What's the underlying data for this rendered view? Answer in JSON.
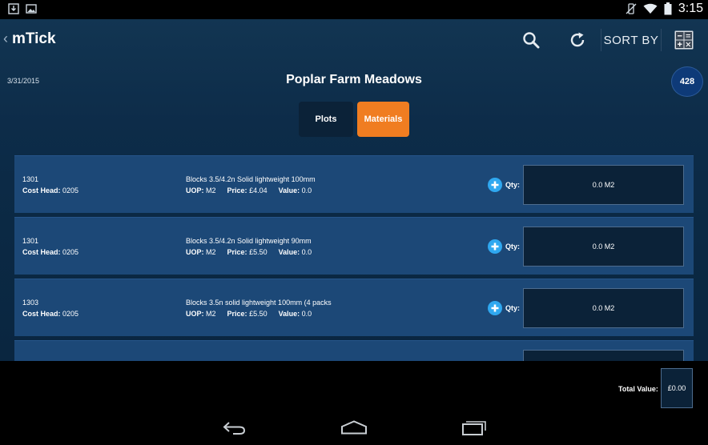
{
  "status": {
    "time": "3:15",
    "icons": [
      "download-icon",
      "image-icon",
      "vibrate-off-icon",
      "wifi-icon",
      "battery-icon"
    ]
  },
  "app": {
    "title": "mTick",
    "sort_label": "SORT BY",
    "date": "3/31/2015",
    "site_name": "Poplar Farm Meadows",
    "badge_count": "428"
  },
  "tabs": {
    "plots": "Plots",
    "materials": "Materials",
    "active": "materials",
    "active_color": "#f07d21"
  },
  "materials": [
    {
      "code": "1301",
      "cost_head_label": "Cost Head:",
      "cost_head": "0205",
      "description": "Blocks 3.5/4.2n Solid lightweight 100mm",
      "uop_label": "UOP:",
      "uop": "M2",
      "price_label": "Price:",
      "price": "£4.04",
      "value_label": "Value:",
      "value": "0.0",
      "qty_label": "Qty:",
      "qty": "0.0 M2"
    },
    {
      "code": "1301",
      "cost_head_label": "Cost Head:",
      "cost_head": "0205",
      "description": "Blocks 3.5/4.2n Solid lightweight 90mm",
      "uop_label": "UOP:",
      "uop": "M2",
      "price_label": "Price:",
      "price": "£5.50",
      "value_label": "Value:",
      "value": "0.0",
      "qty_label": "Qty:",
      "qty": "0.0 M2"
    },
    {
      "code": "1303",
      "cost_head_label": "Cost Head:",
      "cost_head": "0205",
      "description": "Blocks 3.5n solid lightweight 100mm (4 packs",
      "uop_label": "UOP:",
      "uop": "M2",
      "price_label": "Price:",
      "price": "£5.50",
      "value_label": "Value:",
      "value": "0.0",
      "qty_label": "Qty:",
      "qty": "0.0 M2"
    },
    {
      "code": "",
      "cost_head_label": "",
      "cost_head": "",
      "description": "",
      "uop_label": "",
      "uop": "",
      "price_label": "",
      "price": "",
      "value_label": "",
      "value": "",
      "qty_label": "",
      "qty": ""
    }
  ],
  "footer": {
    "total_label": "Total Value:",
    "total_value": "£0.00"
  },
  "nav": [
    "back-icon",
    "home-icon",
    "recents-icon"
  ]
}
